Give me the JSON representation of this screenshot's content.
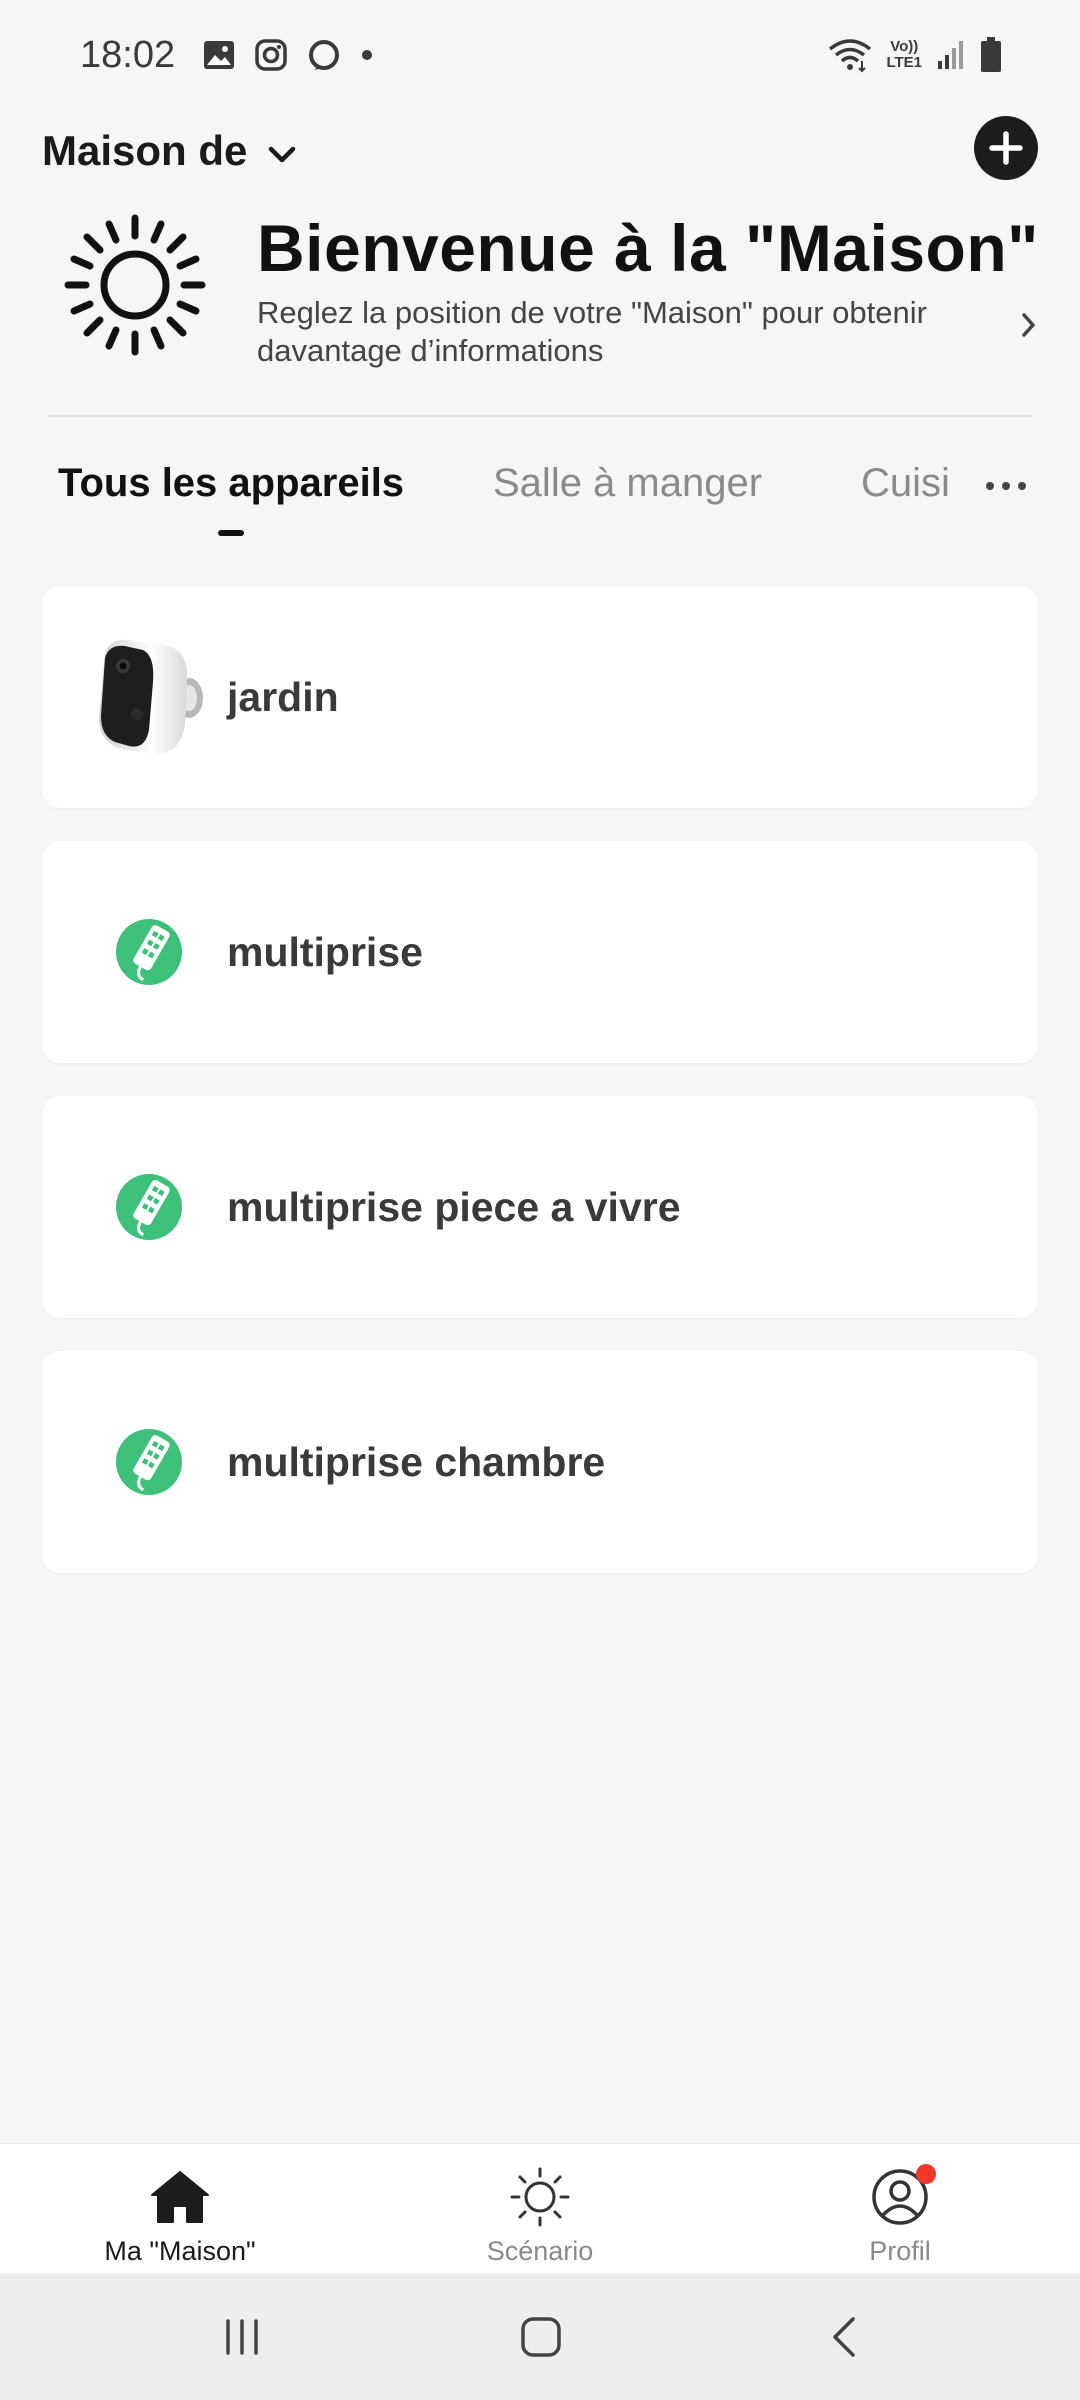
{
  "status_bar": {
    "time": "18:02",
    "left_icons": [
      "gallery-icon",
      "instagram-icon",
      "alexa-icon",
      "dot-icon"
    ],
    "right_icons": [
      "wifi-icon",
      "volte-icon",
      "signal-icon",
      "battery-icon"
    ],
    "volte_text": "Vo))",
    "lte_text": "LTE1"
  },
  "header": {
    "home_name": "Maison de",
    "add_icon": "plus-icon"
  },
  "welcome": {
    "title": "Bienvenue à la \"Maison\"",
    "subtitle": "Reglez la position de votre \"Maison\" pour obtenir davantage d’informations",
    "weather_icon": "sun-icon"
  },
  "tabs": [
    {
      "label": "Tous les appareils",
      "active": true
    },
    {
      "label": "Salle à manger",
      "active": false
    },
    {
      "label": "Cuisi",
      "active": false
    }
  ],
  "devices": [
    {
      "name": "jardin",
      "icon": "camera-icon"
    },
    {
      "name": "multiprise",
      "icon": "power-strip-icon"
    },
    {
      "name": "multiprise piece a vivre",
      "icon": "power-strip-icon"
    },
    {
      "name": "multiprise chambre",
      "icon": "power-strip-icon"
    }
  ],
  "bottom_nav": [
    {
      "label": "Ma \"Maison\"",
      "icon": "home-icon",
      "active": true
    },
    {
      "label": "Scénario",
      "icon": "sun-outline-icon",
      "active": false
    },
    {
      "label": "Profil",
      "icon": "profile-icon",
      "active": false,
      "badge": true
    }
  ],
  "colors": {
    "background": "#f6f6f6",
    "card": "#ffffff",
    "accent_green": "#3cc07a",
    "badge_red": "#f0392b",
    "text_primary": "#1c1c1c"
  }
}
